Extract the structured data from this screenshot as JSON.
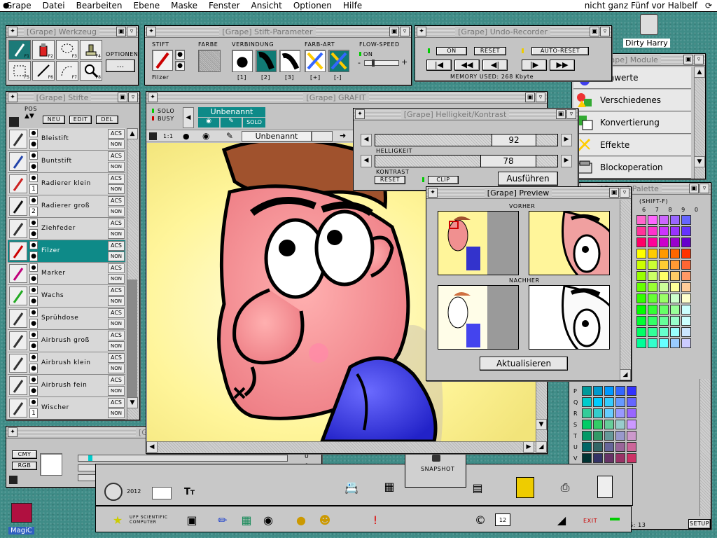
{
  "menubar": {
    "items": [
      "Grape",
      "Datei",
      "Bearbeiten",
      "Ebene",
      "Maske",
      "Fenster",
      "Ansicht",
      "Optionen",
      "Hilfe"
    ],
    "clock": "nicht ganz Fünf vor Halbelf"
  },
  "desktop": {
    "dirty_harry": "Dirty Harry",
    "magic_label": "MagiC"
  },
  "werkzeug": {
    "title": "[Grape] Werkzeug",
    "optionen_label": "OPTIONEN",
    "optionen_button": "...",
    "function_keys": [
      "F1",
      "F2",
      "F3",
      "F4",
      "F5",
      "F6",
      "F7",
      "F8"
    ]
  },
  "stift_parameter": {
    "title": "[Grape] Stift-Parameter",
    "stift": "STIFT",
    "farbe": "FARBE",
    "verbindung": "VERBINDUNG",
    "farbart": "FARB-ART",
    "flow": "FLOW-SPEED",
    "stift_name": "Filzer",
    "on": "ON",
    "conn_labels": [
      "[1]",
      "[2]",
      "[3]"
    ],
    "art_labels": [
      "[+]",
      "[-]"
    ],
    "minus": "-",
    "plus": "+"
  },
  "undo": {
    "title": "[Grape] Undo-Recorder",
    "on": "ON",
    "reset": "RESET",
    "auto_reset": "AUTO-RESET",
    "memory": "MEMORY USED: 268 Kbyte"
  },
  "stifte": {
    "title": "[Grape] Stifte",
    "pos": "POS",
    "buttons": {
      "neu": "NEU",
      "edit": "EDIT",
      "del": "DEL"
    },
    "ac": "ACS",
    "non": "NON",
    "pens": [
      "Bleistift",
      "Buntstift",
      "Radierer klein",
      "Radierer groß",
      "Ziehfeder",
      "Filzer",
      "Marker",
      "Wachs",
      "Sprühdose",
      "Airbrush groß",
      "Airbrush klein",
      "Airbrush fein",
      "Wischer"
    ],
    "numbers": [
      "1",
      "2",
      "1"
    ]
  },
  "grafit": {
    "title": "[Grape] GRAFIT",
    "solo": "SOLO",
    "busy": "BUSY",
    "layer_name": "Unbenannt",
    "solo_btn": "SOLO",
    "zoom": "1:1",
    "layer_field": "Unbenannt"
  },
  "hk": {
    "title": "[Grape] Helligkeit/Kontrast",
    "helligkeit_label": "HELLIGKEIT",
    "helligkeit_value": "92",
    "kontrast_label": "KONTRAST",
    "kontrast_value": "78",
    "reset": "RESET",
    "clip": "CLIP",
    "ausfuehren": "Ausführen",
    "helligkeit_fraction": 0.64,
    "kontrast_fraction": 0.57
  },
  "module": {
    "title": "[Grape] Module",
    "items": [
      "Tonwerte",
      "Verschiedenes",
      "Konvertierung",
      "Effekte",
      "Blockoperation"
    ]
  },
  "preview": {
    "title": "[Grape] Preview",
    "vorher": "VORHER",
    "nachher": "NACHHER",
    "aktualisieren": "Aktualisieren"
  },
  "palette": {
    "title": "[Grape] Palette",
    "shift": "(SHIFT-F)",
    "cols": [
      "6",
      "7",
      "8",
      "9",
      "0"
    ],
    "rows": [
      "P",
      "Q",
      "R",
      "S",
      "T",
      "U",
      "V"
    ],
    "footer": "S: 13",
    "setup": "SETUP",
    "colors": {
      "top": [
        "#ff66cc",
        "#ff66ff",
        "#cc66ff",
        "#9966ff",
        "#6666ff",
        "#ff3399",
        "#ff33cc",
        "#cc33ff",
        "#9933ff",
        "#6633ff",
        "#ff0066",
        "#ff0099",
        "#cc00cc",
        "#9900cc",
        "#6600cc",
        "#ffff00",
        "#ffcc00",
        "#ff9900",
        "#ff6600",
        "#ff3300",
        "#ccff00",
        "#ccff33",
        "#ffcc33",
        "#ff9933",
        "#ff6633",
        "#99ff00",
        "#ccff66",
        "#ffff66",
        "#ffcc66",
        "#ff9966",
        "#66ff00",
        "#99ff33",
        "#ccff99",
        "#ffff99",
        "#ffcc99",
        "#33ff00",
        "#66ff33",
        "#99ff66",
        "#ccffcc",
        "#ffffcc",
        "#00ff00",
        "#33ff33",
        "#66ff66",
        "#99ff99",
        "#ccffff",
        "#00ff33",
        "#33ff66",
        "#66ff99",
        "#99ffcc",
        "#ccffff",
        "#00ff66",
        "#33ff99",
        "#66ffcc",
        "#99ffff",
        "#cce6ff",
        "#00ff99",
        "#33ffcc",
        "#66ffff",
        "#99ccff",
        "#ccccff"
      ],
      "bottom": [
        "#009999",
        "#0099cc",
        "#0099ff",
        "#3366ff",
        "#3333ff",
        "#00cccc",
        "#00ccff",
        "#33ccff",
        "#6699ff",
        "#6666ff",
        "#33cc99",
        "#33cccc",
        "#66ccff",
        "#9999ff",
        "#9966ff",
        "#00cc66",
        "#33cc66",
        "#66cc99",
        "#99cccc",
        "#cc99ff",
        "#009966",
        "#339966",
        "#669999",
        "#9999cc",
        "#cc99cc",
        "#006666",
        "#336666",
        "#666699",
        "#996699",
        "#cc6699",
        "#003333",
        "#333366",
        "#663366",
        "#993366",
        "#cc3366"
      ]
    }
  },
  "mixer": {
    "title": "[Grape]",
    "cmy": "CMY",
    "rgb": "RGB",
    "zero": "0"
  },
  "snapshot": {
    "label": "SNAPSHOT"
  },
  "dock": {
    "year": "2012",
    "exit": "EXIT",
    "ufp": "UFP SCIENTIFIC COMPUTER"
  },
  "colors": {
    "accent": "#0e8a88",
    "canvas_bg": "#fff8a8"
  }
}
